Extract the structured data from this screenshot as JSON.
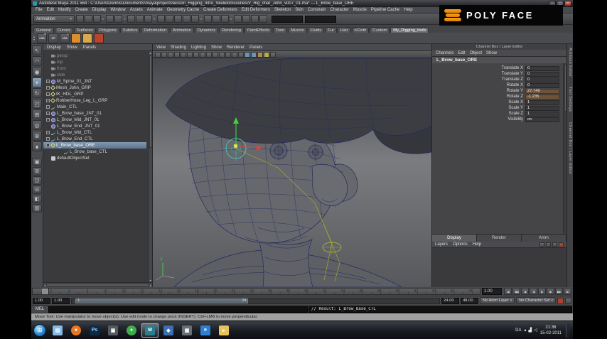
{
  "window": {
    "title": "Autodesk Maya 2011 x64 : C:\\Users\\Dennis\\Documents\\maya\\projects\\lesson_Rigging_Intro_Skeleton\\scenes\\V_Rig_char_John_v007_01.ma* --- L_Brow_base_ORE",
    "menus": [
      "File",
      "Edit",
      "Modify",
      "Create",
      "Display",
      "Window",
      "Assets",
      "Animate",
      "Geometry Cache",
      "Create Deformers",
      "Edit Deformers",
      "Skeleton",
      "Skin",
      "Constrain",
      "Character",
      "Muscle",
      "Pipeline Cache",
      "Help"
    ],
    "controls": [
      {
        "name": "minimize-button",
        "glyph": "–"
      },
      {
        "name": "maximize-button",
        "glyph": "▢"
      },
      {
        "name": "close-button",
        "glyph": "×"
      }
    ]
  },
  "logo": {
    "text": "POLY FACE"
  },
  "ui_glyphs": {
    "dropdown": "▾",
    "collapse": "▸",
    "scroll_up": "▴",
    "scroll_down": "▾",
    "scroll_left": "◂",
    "scroll_right": "▸",
    "start": "⊞",
    "shelf_up": "▴",
    "shelf_down": "▾"
  },
  "statusline": {
    "mode": "Animation",
    "icon_groups": [
      [
        "new-scene-icon",
        "open-scene-icon",
        "save-scene-icon"
      ],
      [
        "undo-icon",
        "redo-icon"
      ],
      [
        "select-hierarchy-icon",
        "select-object-icon",
        "select-component-icon"
      ],
      [
        "snap-grid-icon",
        "snap-curve-icon",
        "snap-point-icon",
        "snap-plane-icon",
        "make-live-icon"
      ],
      [
        "input-connections-icon",
        "construction-history-icon",
        "output-connections-icon"
      ],
      [
        "render-view-icon",
        "render-current-frame-icon",
        "ipr-render-icon",
        "render-settings-icon"
      ]
    ],
    "fields": [
      "",
      ""
    ]
  },
  "shelf": {
    "tabs": [
      "General",
      "Curves",
      "Surfaces",
      "Polygons",
      "Subdivs",
      "Deformation",
      "Animation",
      "Dynamics",
      "Rendering",
      "PaintEffects",
      "Toon",
      "Muscle",
      "Fluids",
      "Fur",
      "Hair",
      "nCloth",
      "Custom",
      "My_Rigging_tools"
    ],
    "active_tab": "My_Rigging_tools",
    "icons": [
      {
        "name": "lra-show-icon",
        "label": "LRA",
        "badge": "+",
        "badge_color": "#7ddb7d"
      },
      {
        "name": "cp-tool-icon",
        "label": "CP"
      },
      {
        "name": "lra-hide-icon",
        "label": "LRA",
        "badge": "−",
        "badge_color": "#e07d7d"
      },
      {
        "name": "orange-rig-tool-icon",
        "color": "#d98f2b"
      },
      {
        "name": "orange-curve-tool-icon",
        "color": "#dba94d"
      },
      {
        "name": "red-rig-tool-icon",
        "color": "#b8452b"
      }
    ]
  },
  "toolbox": {
    "tools": [
      {
        "name": "select-tool",
        "glyph": "↖"
      },
      {
        "name": "lasso-select-tool",
        "glyph": "◠"
      },
      {
        "name": "paint-select-tool",
        "glyph": "◉"
      },
      {
        "name": "move-tool",
        "glyph": "+",
        "active": true
      },
      {
        "name": "rotate-tool",
        "glyph": "↻"
      },
      {
        "name": "scale-tool",
        "glyph": "◰"
      },
      {
        "name": "universal-manipulator-tool",
        "glyph": "⊞"
      },
      {
        "name": "soft-modification-tool",
        "glyph": "◎"
      },
      {
        "name": "show-manipulator-tool",
        "glyph": "⊕"
      },
      {
        "name": "last-tool",
        "glyph": "∎"
      }
    ],
    "layouts": [
      {
        "name": "single-pane-layout-button",
        "glyph": "▣"
      },
      {
        "name": "four-pane-layout-button",
        "glyph": "⊞"
      },
      {
        "name": "two-pane-side-layout-button",
        "glyph": "◫"
      },
      {
        "name": "two-pane-stacked-layout-button",
        "glyph": "⊟"
      },
      {
        "name": "three-pane-layout-button",
        "glyph": "◧"
      },
      {
        "name": "outliner-persp-layout-button",
        "glyph": "▥"
      }
    ]
  },
  "outliner": {
    "menus": [
      "Display",
      "Show",
      "Panels"
    ],
    "items": [
      {
        "label": "persp",
        "type": "camera",
        "dim": true
      },
      {
        "label": "top",
        "type": "camera",
        "dim": true
      },
      {
        "label": "front",
        "type": "camera",
        "dim": true
      },
      {
        "label": "side",
        "type": "camera",
        "dim": true
      },
      {
        "label": "M_Spine_01_JNT",
        "type": "joint",
        "toggle": "+"
      },
      {
        "label": "Mesh_John_GRP",
        "type": "group",
        "toggle": "+"
      },
      {
        "label": "IK_HDL_GRP",
        "type": "group",
        "toggle": "+"
      },
      {
        "label": "RobberHose_Leg_L_GRP",
        "type": "group",
        "toggle": "+"
      },
      {
        "label": "Main_CTL",
        "type": "curve",
        "toggle": "+"
      },
      {
        "label": "L_Brow_base_JNT_01",
        "type": "joint",
        "toggle": "+"
      },
      {
        "label": "L_Brow_Mid_JNT_01",
        "type": "joint",
        "toggle": "+"
      },
      {
        "label": "L_Brow_End_JNT_01",
        "type": "joint"
      },
      {
        "label": "L_Brow_Mid_CTL",
        "type": "curve",
        "toggle": "+"
      },
      {
        "label": "L_Brow_End_CTL",
        "type": "curve",
        "toggle": "+"
      },
      {
        "label": "L_Brow_base_ORE",
        "type": "group",
        "toggle": "−",
        "selected": true
      },
      {
        "label": "L_Brow_base_CTL",
        "type": "curve",
        "child": true
      },
      {
        "label": "defaultObjectSet",
        "type": "set"
      }
    ]
  },
  "viewport": {
    "menus": [
      "View",
      "Shading",
      "Lighting",
      "Show",
      "Renderer",
      "Panels"
    ],
    "toolbar_icons": [
      {
        "name": "select-camera-icon"
      },
      {
        "name": "lock-camera-icon"
      },
      {
        "name": "camera-attributes-icon"
      },
      {
        "name": "bookmarks-icon"
      },
      {
        "name": "image-plane-icon"
      },
      {
        "name": "2d-pan-zoom-icon"
      },
      {
        "name": "grease-pencil-icon"
      },
      {
        "name": "grid-icon"
      },
      {
        "name": "film-gate-icon"
      },
      {
        "name": "resolution-gate-icon"
      },
      {
        "name": "gate-mask-icon"
      },
      {
        "name": "field-chart-icon"
      },
      {
        "name": "safe-action-icon"
      },
      {
        "name": "safe-title-icon"
      },
      {
        "name": "wireframe-icon",
        "color": "#6f93b5"
      },
      {
        "name": "shaded-icon",
        "color": "#6f93b5"
      },
      {
        "name": "textured-icon",
        "color": "#b08a50"
      },
      {
        "name": "lights-icon",
        "color": "#b0b050"
      },
      {
        "name": "isolate-select-icon"
      }
    ],
    "axis_label": "Y"
  },
  "channelbox": {
    "panel_title": "Channel Box / Layer Editor",
    "menus": [
      "Channels",
      "Edit",
      "Object",
      "Show"
    ],
    "node": "L_Brow_base_ORE",
    "channels": [
      {
        "name": "Translate X",
        "value": "0"
      },
      {
        "name": "Translate Y",
        "value": "0"
      },
      {
        "name": "Translate Z",
        "value": "0"
      },
      {
        "name": "Rotate X",
        "value": "0"
      },
      {
        "name": "Rotate Y",
        "value": "27.749",
        "keyed": true
      },
      {
        "name": "Rotate Z",
        "value": "-1.235",
        "keyed": true
      },
      {
        "name": "Scale X",
        "value": "1"
      },
      {
        "name": "Scale Y",
        "value": "1"
      },
      {
        "name": "Scale Z",
        "value": "1"
      },
      {
        "name": "Visibility",
        "value": "on"
      }
    ]
  },
  "layer_editor": {
    "tabs": [
      "Display",
      "Render",
      "Anim"
    ],
    "active_tab": "Display",
    "menus": [
      "Layers",
      "Options",
      "Help"
    ],
    "icons": [
      {
        "name": "new-empty-layer-icon"
      },
      {
        "name": "new-layer-from-selected-icon"
      },
      {
        "name": "layer-options-icon"
      },
      {
        "name": "delete-layer-icon",
        "color": "#a04838"
      }
    ]
  },
  "right_tabs": [
    "Attribute Editor",
    "Tool Settings",
    "Channel Box / Layer Editor"
  ],
  "timeline": {
    "ticks": [
      2,
      4,
      6,
      8,
      10,
      12,
      14,
      16,
      18,
      20,
      22,
      24,
      26,
      28,
      30,
      32,
      34,
      36,
      38,
      40,
      42,
      44,
      46,
      48
    ],
    "max": 49,
    "current_frame_marker": 1,
    "current_frame": "1.00",
    "playback": [
      {
        "name": "go-to-start-button",
        "glyph": "|◀"
      },
      {
        "name": "step-back-frame-button",
        "glyph": "◀◀"
      },
      {
        "name": "step-back-key-button",
        "glyph": "◀|"
      },
      {
        "name": "play-backwards-button",
        "glyph": "◀"
      },
      {
        "name": "play-forwards-button",
        "glyph": "▶"
      },
      {
        "name": "step-forward-key-button",
        "glyph": "|▶"
      },
      {
        "name": "step-forward-frame-button",
        "glyph": "▶▶"
      },
      {
        "name": "go-to-end-button",
        "glyph": "▶|"
      }
    ]
  },
  "range": {
    "fields_left": [
      "1.00",
      "1.00"
    ],
    "bar_start_label": "1",
    "bar_end_label": "24",
    "fields_right": [
      "24.00",
      "48.00"
    ],
    "anim_layer": "No Anim Layer",
    "character_set": "No Character Set",
    "icons": [
      {
        "name": "auto-keyframe-icon",
        "color": "#b04030"
      },
      {
        "name": "animation-preferences-icon"
      }
    ]
  },
  "command_line": {
    "label": "MEL",
    "input_value": "",
    "result": "// Result: L_Brow_base_CTL"
  },
  "help_line": {
    "text": "Move Tool: Use manipulator to move object(s). Use edit mode to change pivot (INSERT). Ctrl+LMB to move perpendicular."
  },
  "taskbar": {
    "items": [
      {
        "name": "windows-explorer-icon",
        "color": "#86b9e8",
        "glyph": "▤"
      },
      {
        "name": "firefox-icon",
        "color": "#e87722",
        "glyph": "●",
        "round": true
      },
      {
        "name": "photoshop-icon",
        "color": "#0d2a44",
        "glyph": "Ps",
        "text_color": "#9fd0f5"
      },
      {
        "name": "app-icon-1",
        "color": "#555a60",
        "glyph": "▣"
      },
      {
        "name": "app-icon-2",
        "color": "#3fae4a",
        "glyph": "●",
        "round": true
      },
      {
        "name": "maya-icon",
        "color": "#2a7f8f",
        "glyph": "M",
        "active": true
      },
      {
        "name": "app-icon-3",
        "color": "#3a6fb0",
        "glyph": "◆"
      },
      {
        "name": "app-icon-4",
        "color": "#6a6f75",
        "glyph": "▦"
      },
      {
        "name": "internet-explorer-icon",
        "color": "#2f7fd0",
        "glyph": "e"
      },
      {
        "name": "folder-icon",
        "color": "#e8c25a",
        "glyph": "▸"
      }
    ],
    "tray": {
      "lang": "DA",
      "icons": [
        {
          "name": "hidden-icons-chevron",
          "glyph": "▴"
        },
        {
          "name": "network-icon",
          "glyph": "▟"
        },
        {
          "name": "volume-icon",
          "glyph": "◁"
        }
      ],
      "time": "21:36",
      "date": "15-02-2011"
    }
  }
}
